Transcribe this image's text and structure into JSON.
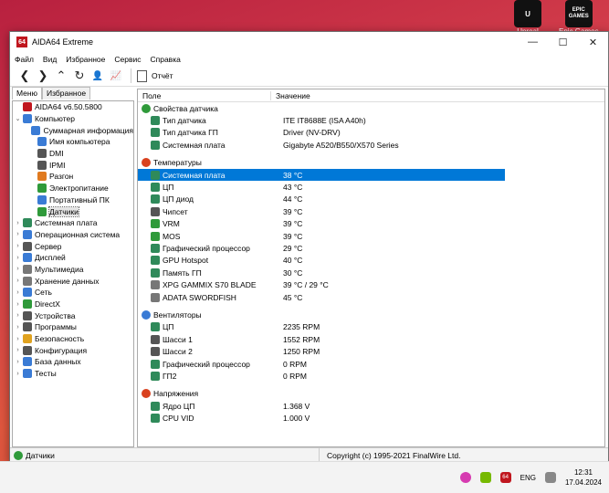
{
  "desktop": {
    "icons": [
      {
        "label": "Unreal",
        "badge": "U"
      },
      {
        "label": "Epic Games",
        "badge": "EPIC GAMES"
      }
    ]
  },
  "window": {
    "title": "AIDA64 Extreme",
    "app_badge": "64",
    "min_glyph": "—",
    "max_glyph": "☐",
    "close_glyph": "✕"
  },
  "menu": [
    "Файл",
    "Вид",
    "Избранное",
    "Сервис",
    "Справка"
  ],
  "toolbar": {
    "back_glyph": "❮",
    "forward_glyph": "❯",
    "up_glyph": "⌃",
    "refresh_glyph": "↻",
    "user_glyph": "👤",
    "chart_glyph": "📈",
    "report_label": "Отчёт"
  },
  "left_panel": {
    "tabs": [
      "Меню",
      "Избранное"
    ],
    "tree": [
      {
        "label": "AIDA64 v6.50.5800",
        "level": 0,
        "toggle": "",
        "color": "#c0161e"
      },
      {
        "label": "Компьютер",
        "level": 0,
        "toggle": "⌄",
        "color": "#3a7bd5"
      },
      {
        "label": "Суммарная информация",
        "level": 1,
        "toggle": "",
        "color": "#3a7bd5"
      },
      {
        "label": "Имя компьютера",
        "level": 1,
        "toggle": "",
        "color": "#3a7bd5"
      },
      {
        "label": "DMI",
        "level": 1,
        "toggle": "",
        "color": "#555555"
      },
      {
        "label": "IPMI",
        "level": 1,
        "toggle": "",
        "color": "#555555"
      },
      {
        "label": "Разгон",
        "level": 1,
        "toggle": "",
        "color": "#e07a1f"
      },
      {
        "label": "Электропитание",
        "level": 1,
        "toggle": "",
        "color": "#2f9a3a"
      },
      {
        "label": "Портативный ПК",
        "level": 1,
        "toggle": "",
        "color": "#3a7bd5"
      },
      {
        "label": "Датчики",
        "level": 1,
        "toggle": "",
        "color": "#2f9a3a",
        "selected": true
      },
      {
        "label": "Системная плата",
        "level": 0,
        "toggle": "›",
        "color": "#2f8a5a"
      },
      {
        "label": "Операционная система",
        "level": 0,
        "toggle": "›",
        "color": "#3a7bd5"
      },
      {
        "label": "Сервер",
        "level": 0,
        "toggle": "›",
        "color": "#555555"
      },
      {
        "label": "Дисплей",
        "level": 0,
        "toggle": "›",
        "color": "#3a7bd5"
      },
      {
        "label": "Мультимедиа",
        "level": 0,
        "toggle": "›",
        "color": "#777777"
      },
      {
        "label": "Хранение данных",
        "level": 0,
        "toggle": "›",
        "color": "#777777"
      },
      {
        "label": "Сеть",
        "level": 0,
        "toggle": "›",
        "color": "#3a7bd5"
      },
      {
        "label": "DirectX",
        "level": 0,
        "toggle": "›",
        "color": "#2f9a3a"
      },
      {
        "label": "Устройства",
        "level": 0,
        "toggle": "›",
        "color": "#555555"
      },
      {
        "label": "Программы",
        "level": 0,
        "toggle": "›",
        "color": "#555555"
      },
      {
        "label": "Безопасность",
        "level": 0,
        "toggle": "›",
        "color": "#e0a21f"
      },
      {
        "label": "Конфигурация",
        "level": 0,
        "toggle": "›",
        "color": "#555555"
      },
      {
        "label": "База данных",
        "level": 0,
        "toggle": "›",
        "color": "#3a7bd5"
      },
      {
        "label": "Тесты",
        "level": 0,
        "toggle": "›",
        "color": "#3a7bd5"
      }
    ]
  },
  "table": {
    "col_field": "Поле",
    "col_value": "Значение",
    "sections": [
      {
        "title": "Свойства датчика",
        "color": "#2f9a3a",
        "rows": [
          {
            "field": "Тип датчика",
            "value": "ITE IT8688E  (ISA A40h)",
            "color": "#2f8a5a"
          },
          {
            "field": "Тип датчика ГП",
            "value": "Driver  (NV-DRV)",
            "color": "#2f8a5a"
          },
          {
            "field": "Системная плата",
            "value": "Gigabyte A520/B550/X570 Series",
            "color": "#2f8a5a"
          }
        ]
      },
      {
        "title": "Температуры",
        "color": "#d9411e",
        "rows": [
          {
            "field": "Системная плата",
            "value": "38 °C",
            "color": "#2f8a5a",
            "highlight": true
          },
          {
            "field": "ЦП",
            "value": "43 °C",
            "color": "#2f8a5a"
          },
          {
            "field": "ЦП диод",
            "value": "44 °C",
            "color": "#2f8a5a"
          },
          {
            "field": "Чипсет",
            "value": "39 °C",
            "color": "#555555"
          },
          {
            "field": "VRM",
            "value": "39 °C",
            "color": "#2f9a3a"
          },
          {
            "field": "MOS",
            "value": "39 °C",
            "color": "#2f9a3a"
          },
          {
            "field": "Графический процессор",
            "value": "29 °C",
            "color": "#2f8a5a"
          },
          {
            "field": "GPU Hotspot",
            "value": "40 °C",
            "color": "#2f8a5a"
          },
          {
            "field": "Память ГП",
            "value": "30 °C",
            "color": "#2f8a5a"
          },
          {
            "field": "XPG GAMMIX S70 BLADE",
            "value": "39 °C / 29 °C",
            "color": "#777777"
          },
          {
            "field": "ADATA SWORDFISH",
            "value": "45 °C",
            "color": "#777777"
          }
        ]
      },
      {
        "title": "Вентиляторы",
        "color": "#3a7bd5",
        "rows": [
          {
            "field": "ЦП",
            "value": "2235 RPM",
            "color": "#2f8a5a"
          },
          {
            "field": "Шасси 1",
            "value": "1552 RPM",
            "color": "#555555"
          },
          {
            "field": "Шасси 2",
            "value": "1250 RPM",
            "color": "#555555"
          },
          {
            "field": "Графический процессор",
            "value": "0 RPM",
            "color": "#2f8a5a"
          },
          {
            "field": "ГП2",
            "value": "0 RPM",
            "color": "#2f8a5a"
          }
        ]
      },
      {
        "title": "Напряжения",
        "color": "#d9411e",
        "rows": [
          {
            "field": "Ядро ЦП",
            "value": "1.368 V",
            "color": "#2f8a5a"
          },
          {
            "field": "CPU VID",
            "value": "1.000 V",
            "color": "#2f8a5a"
          }
        ]
      }
    ]
  },
  "status": {
    "left": "Датчики",
    "right": "Copyright (c) 1995-2021 FinalWire Ltd."
  },
  "taskbar": {
    "lang": "ENG",
    "time": "12:31",
    "date": "17.04.2024",
    "app_badge": "64"
  }
}
